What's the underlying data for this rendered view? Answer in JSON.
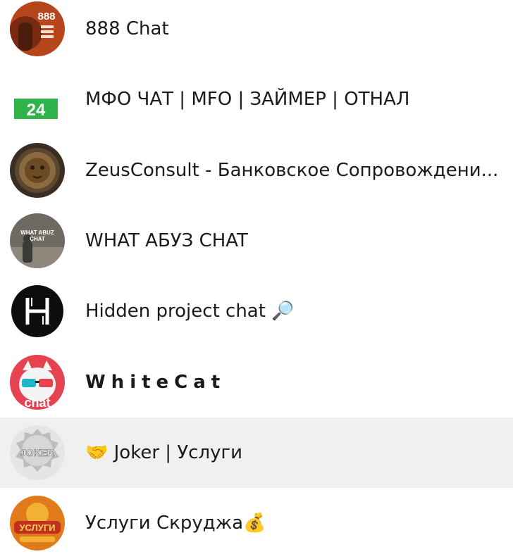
{
  "chats": [
    {
      "title": "888 Chat",
      "avatar_icon": "888-chat-logo",
      "avatar_text": "888"
    },
    {
      "title": "МФО ЧАТ | MFO | ЗАЙМЕР | ОТНАЛ",
      "avatar_icon": "green-24-badge",
      "avatar_text": "24"
    },
    {
      "title": "ZeusConsult - Банковское Сопровождени...",
      "avatar_icon": "lion-emblem-avatar"
    },
    {
      "title": "WHAT АБУЗ CHAT",
      "avatar_icon": "what-abuz-photo-avatar",
      "avatar_text": "WHAT ABUZ CHAT"
    },
    {
      "title": "Hidden project chat 🔎",
      "avatar_icon": "h-monogram-avatar"
    },
    {
      "title": "WhiteCat",
      "avatar_icon": "white-cat-3d-glasses-avatar",
      "avatar_text": "chat"
    },
    {
      "title": "🤝 Joker | Услуги",
      "avatar_icon": "joker-coin-avatar",
      "avatar_text": "JOKER"
    },
    {
      "title": "Услуги Скруджа💰",
      "avatar_icon": "uslugi-gold-avatar",
      "avatar_text": "УСЛУГИ"
    }
  ],
  "colors": {
    "selected_row": "#f0f0f0",
    "text": "#1b1b1b"
  }
}
